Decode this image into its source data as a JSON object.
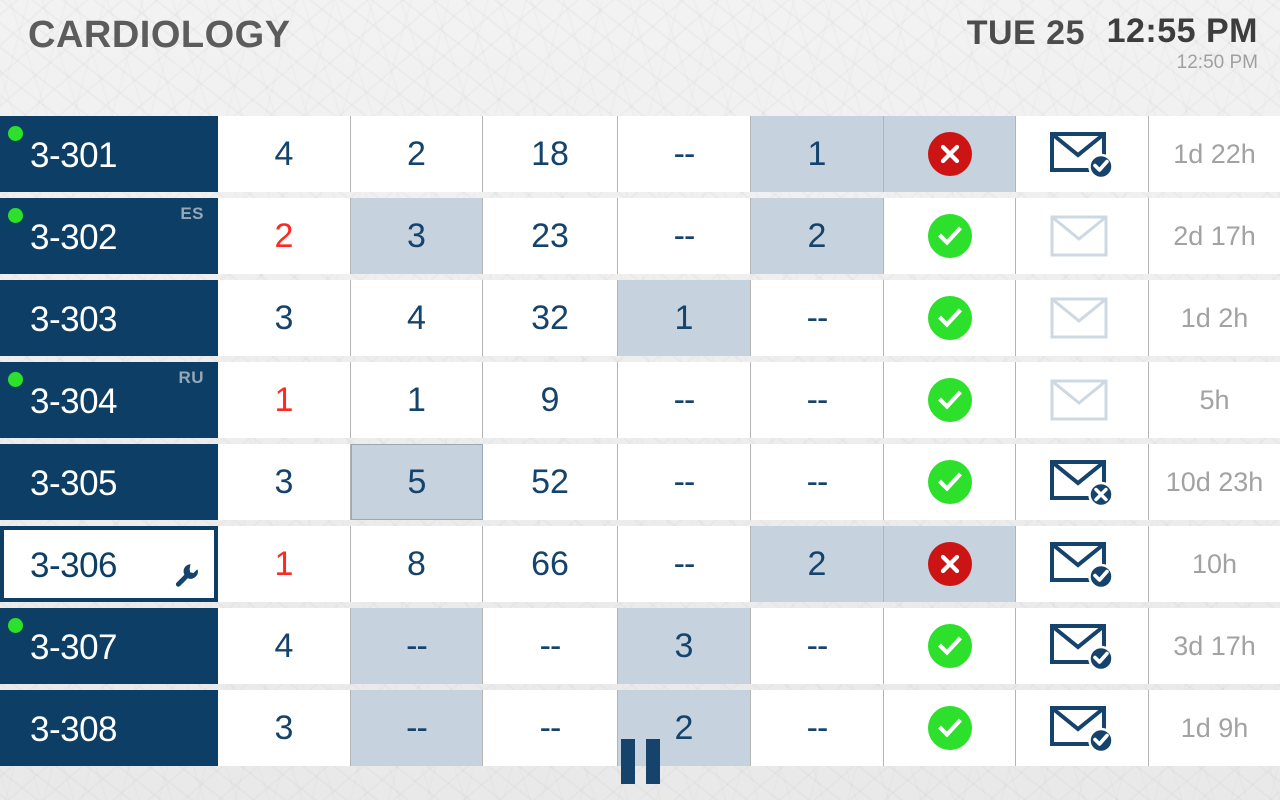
{
  "header": {
    "department": "CARDIOLOGY",
    "date": "TUE 25",
    "time": "12:55 PM",
    "secondary_time": "12:50 PM",
    "title_color": "#5c5c5c"
  },
  "colors": {
    "navy": "#0d3f66",
    "cell_text": "#16436b",
    "alert_red": "#fb2a23",
    "status_green": "#2ce02c",
    "status_red": "#cc1414",
    "highlight": "#c6d2dd",
    "time_gray": "#a2a2a2"
  },
  "footer": {
    "playback_icon": "pause-icon",
    "playback_state": "paused"
  },
  "table": {
    "rows": [
      {
        "room": "3-301",
        "dot": true,
        "lang": "",
        "maintenance": false,
        "selected": false,
        "c1": "4",
        "c1_hl": false,
        "c1_alert": false,
        "c2": "2",
        "c2_hl": false,
        "c3": "18",
        "c3_hl": false,
        "c4": "--",
        "c4_hl": false,
        "c5": "1",
        "c5_hl": true,
        "status": "x",
        "status_hl": true,
        "mail": "check",
        "elapsed": "1d 22h"
      },
      {
        "room": "3-302",
        "dot": true,
        "lang": "ES",
        "maintenance": false,
        "selected": false,
        "c1": "2",
        "c1_hl": false,
        "c1_alert": true,
        "c2": "3",
        "c2_hl": true,
        "c3": "23",
        "c3_hl": false,
        "c4": "--",
        "c4_hl": false,
        "c5": "2",
        "c5_hl": true,
        "status": "ok",
        "status_hl": false,
        "mail": "empty",
        "elapsed": "2d 17h"
      },
      {
        "room": "3-303",
        "dot": false,
        "lang": "",
        "maintenance": false,
        "selected": false,
        "c1": "3",
        "c1_hl": false,
        "c1_alert": false,
        "c2": "4",
        "c2_hl": false,
        "c3": "32",
        "c3_hl": false,
        "c4": "1",
        "c4_hl": true,
        "c5": "--",
        "c5_hl": false,
        "status": "ok",
        "status_hl": false,
        "mail": "empty",
        "elapsed": "1d 2h"
      },
      {
        "room": "3-304",
        "dot": true,
        "lang": "RU",
        "maintenance": false,
        "selected": false,
        "c1": "1",
        "c1_hl": false,
        "c1_alert": true,
        "c2": "1",
        "c2_hl": false,
        "c3": "9",
        "c3_hl": false,
        "c4": "--",
        "c4_hl": false,
        "c5": "--",
        "c5_hl": false,
        "status": "ok",
        "status_hl": false,
        "mail": "empty",
        "elapsed": "5h"
      },
      {
        "room": "3-305",
        "dot": false,
        "lang": "",
        "maintenance": false,
        "selected": false,
        "c1": "3",
        "c1_hl": false,
        "c1_alert": false,
        "c2": "5",
        "c2_hl": "border",
        "c3": "52",
        "c3_hl": false,
        "c4": "--",
        "c4_hl": false,
        "c5": "--",
        "c5_hl": false,
        "status": "ok",
        "status_hl": false,
        "mail": "x",
        "elapsed": "10d 23h"
      },
      {
        "room": "3-306",
        "dot": false,
        "lang": "",
        "maintenance": true,
        "selected": true,
        "c1": "1",
        "c1_hl": false,
        "c1_alert": true,
        "c2": "8",
        "c2_hl": false,
        "c3": "66",
        "c3_hl": false,
        "c4": "--",
        "c4_hl": false,
        "c5": "2",
        "c5_hl": true,
        "status": "x",
        "status_hl": true,
        "mail": "check",
        "elapsed": "10h"
      },
      {
        "room": "3-307",
        "dot": true,
        "lang": "",
        "maintenance": false,
        "selected": false,
        "c1": "4",
        "c1_hl": false,
        "c1_alert": false,
        "c2": "--",
        "c2_hl": true,
        "c3": "--",
        "c3_hl": false,
        "c4": "3",
        "c4_hl": true,
        "c5": "--",
        "c5_hl": false,
        "status": "ok",
        "status_hl": false,
        "mail": "check",
        "elapsed": "3d 17h"
      },
      {
        "room": "3-308",
        "dot": false,
        "lang": "",
        "maintenance": false,
        "selected": false,
        "c1": "3",
        "c1_hl": false,
        "c1_alert": false,
        "c2": "--",
        "c2_hl": true,
        "c3": "--",
        "c3_hl": false,
        "c4": "2",
        "c4_hl": true,
        "c5": "--",
        "c5_hl": false,
        "status": "ok",
        "status_hl": false,
        "mail": "check",
        "elapsed": "1d 9h"
      }
    ]
  }
}
